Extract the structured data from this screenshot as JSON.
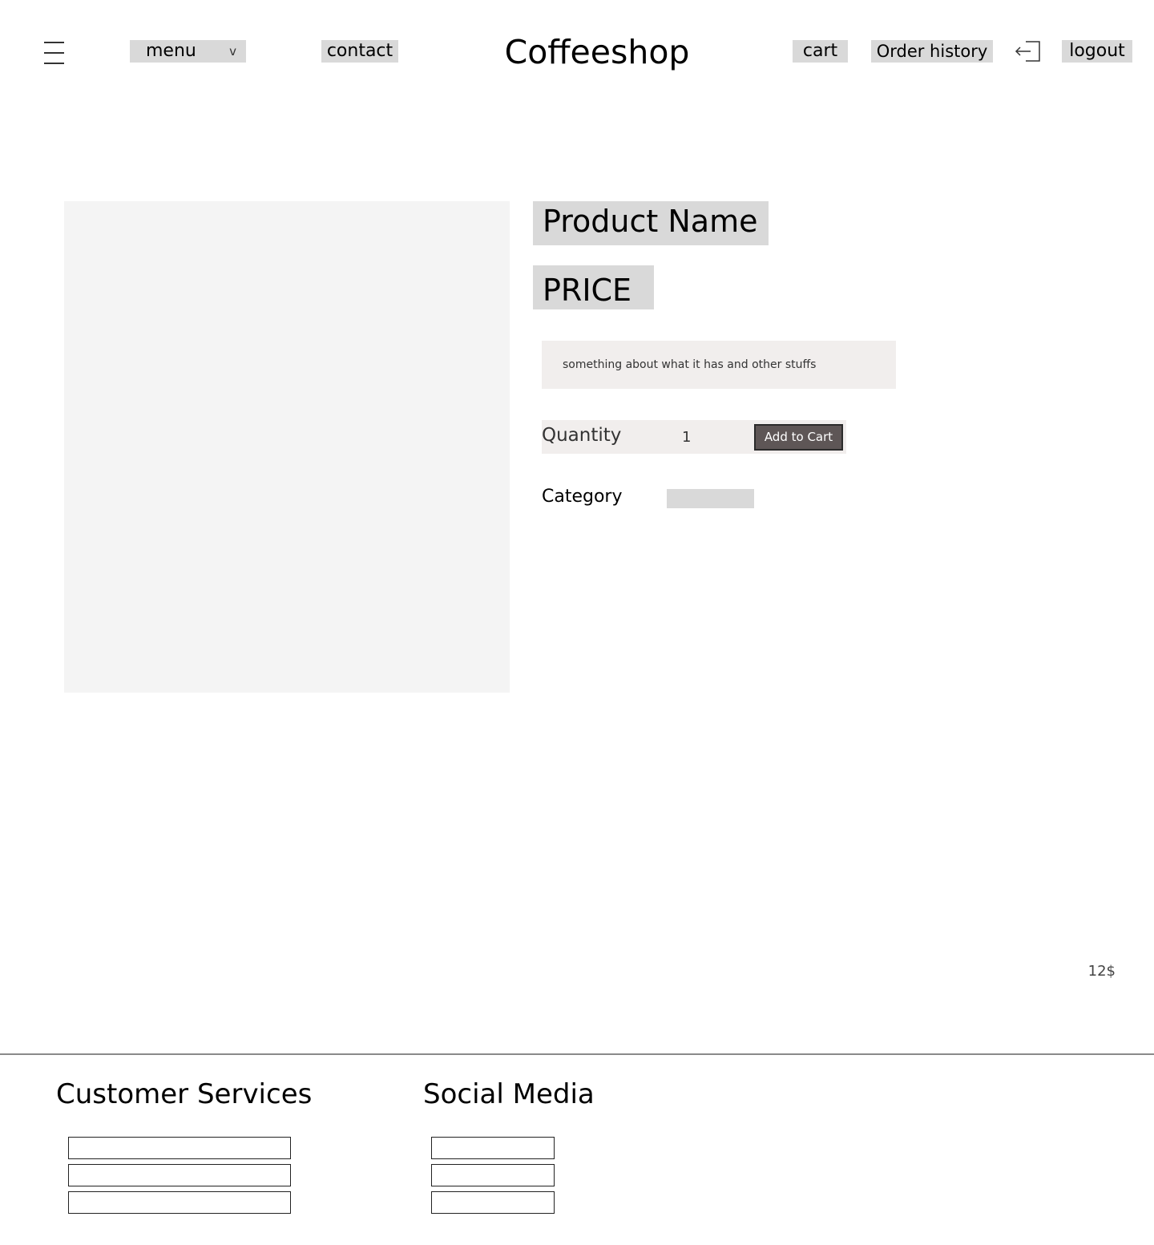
{
  "header": {
    "menu_icon": "hamburger-icon",
    "menu_label": "menu",
    "menu_chevron": "chevron-down-icon",
    "contact_label": "contact",
    "logo_text": "Coffeeshop",
    "cart_label": "cart",
    "order_history_label": "Order history",
    "logout_icon": "logout-icon",
    "logout_label": "logout"
  },
  "product": {
    "image_icon": "product-image-placeholder",
    "name": "Product Name",
    "price": "PRICE",
    "description": "something about what it has and other stuffs",
    "quantity_label": "Quantity",
    "quantity_value": "1",
    "add_to_cart_label": "Add to Cart",
    "category_label": "Category",
    "category_value": ""
  },
  "corner_price": "12$",
  "footer": {
    "customer_services_heading": "Customer Services",
    "social_media_heading": "Social Media"
  },
  "colors": {
    "nav_button_bg": "#d9d9d9",
    "image_placeholder": "#f4f4f4",
    "panel_bg": "#f1eeed",
    "add_to_cart_bg": "#5e5656"
  }
}
